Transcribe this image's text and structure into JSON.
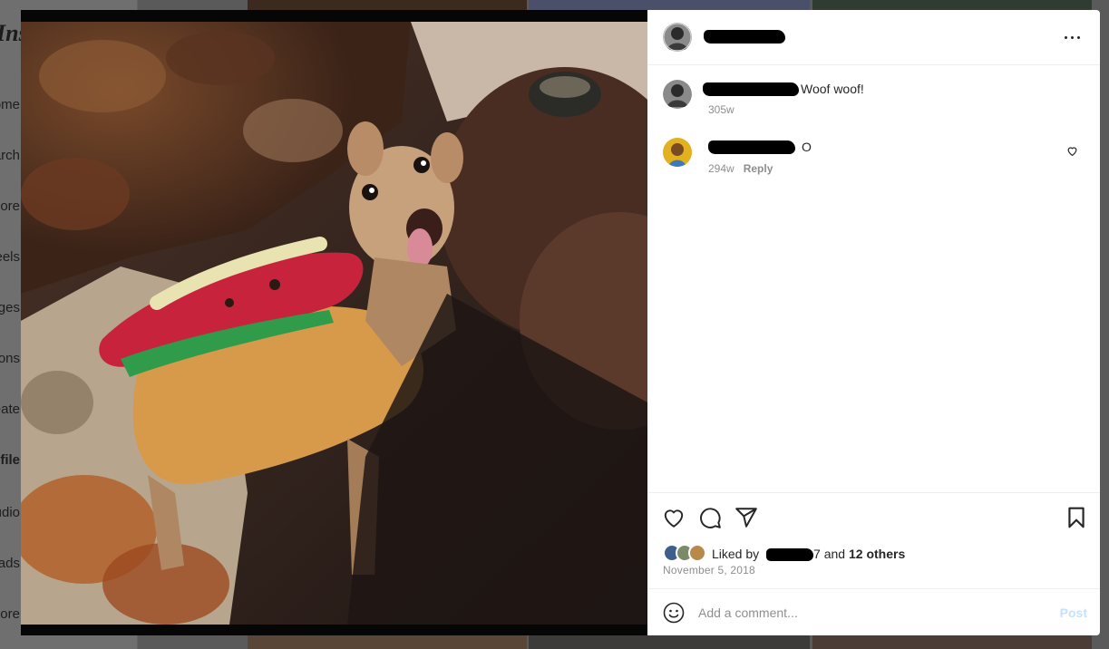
{
  "background": {
    "logo": "Instagram",
    "nav_items": [
      {
        "label": "Home",
        "bold": false
      },
      {
        "label": "Search",
        "bold": false
      },
      {
        "label": "Explore",
        "bold": false
      },
      {
        "label": "Reels",
        "bold": false
      },
      {
        "label": "Messages",
        "bold": false
      },
      {
        "label": "Notifications",
        "bold": false
      },
      {
        "label": "Create",
        "bold": false
      },
      {
        "label": "Profile",
        "bold": true
      },
      {
        "label": "Meta Studio",
        "bold": false
      },
      {
        "label": "Threads",
        "bold": false
      },
      {
        "label": "More",
        "bold": false
      }
    ]
  },
  "post": {
    "author_icon": "author-avatar",
    "more_icon": "more-options-icon",
    "comments": [
      {
        "text": "Woof woof!",
        "time": "305w",
        "reply_label": "",
        "has_like": false
      },
      {
        "text": "O",
        "time": "294w",
        "reply_label": "Reply",
        "has_like": true
      }
    ],
    "actions": {
      "like_icon": "heart-icon",
      "comment_icon": "comment-icon",
      "share_icon": "send-icon",
      "save_icon": "bookmark-icon"
    },
    "liked_by": {
      "prefix": "Liked by",
      "user_suffix": "7",
      "and": "and",
      "others": "12 others"
    },
    "date": "November 5, 2018",
    "add_comment": {
      "placeholder": "Add a comment...",
      "post_label": "Post"
    }
  },
  "colors": {
    "accent_disabled": "#c7e0fb",
    "text": "#262626",
    "muted": "#8e8e8e"
  }
}
